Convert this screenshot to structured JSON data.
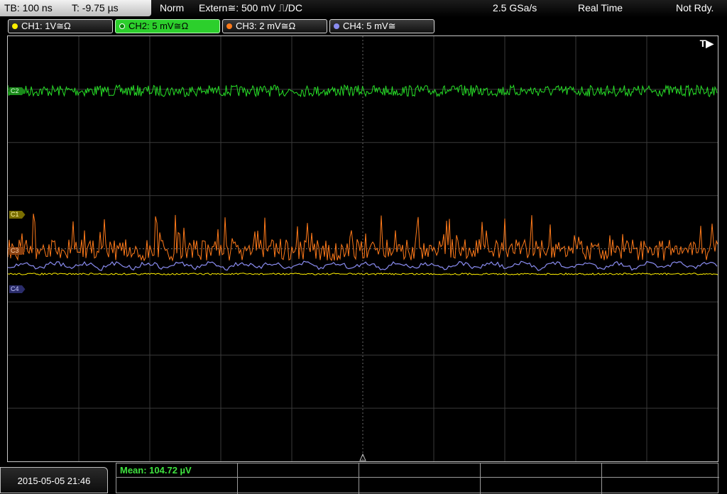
{
  "timebase": {
    "tb": "TB: 100 ns",
    "toffset": "T: -9.75 µs"
  },
  "status": {
    "mode": "Norm",
    "trigger": "Extern≅: 500 mV ⎍/DC",
    "rate": "2.5 GSa/s",
    "acq": "Real Time",
    "ready": "Not Rdy."
  },
  "channels": [
    {
      "label": "CH1: 1V≅Ω",
      "color": "#ffef00"
    },
    {
      "label": "CH2: 5 mV≅Ω",
      "color": "#27e027"
    },
    {
      "label": "CH3: 2 mV≅Ω",
      "color": "#ff7a1a"
    },
    {
      "label": "CH4: 5 mV≅",
      "color": "#8a8cf0"
    }
  ],
  "markers": {
    "c1": "C1",
    "c2": "C2",
    "c3": "C3",
    "c4": "C4"
  },
  "trigger_icon": "T▶",
  "date": "2015-05-05 21:46",
  "measurement": {
    "mean": "Mean: 104.72 µV"
  },
  "colors": {
    "grid": "#3a3a3a",
    "center_axis": "#6a6a6a"
  }
}
